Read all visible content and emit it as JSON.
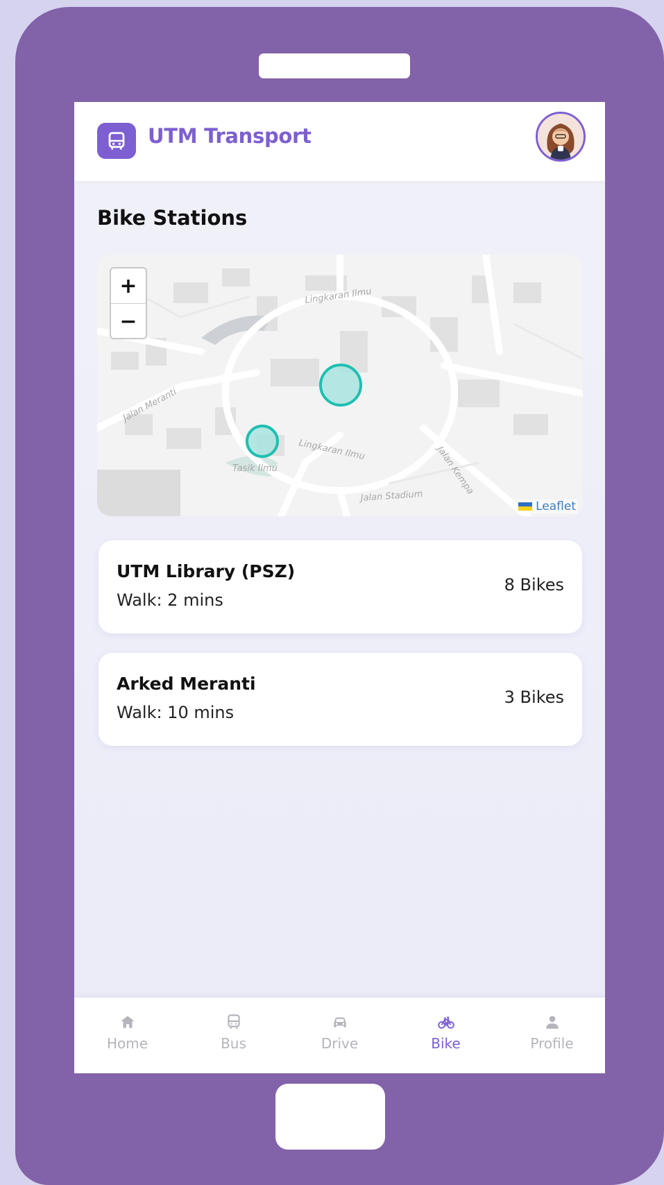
{
  "app": {
    "title": "UTM Transport",
    "logo_icon": "bus-icon",
    "accent_color": "#7d5fd2"
  },
  "page": {
    "title": "Bike Stations"
  },
  "map": {
    "labels": [
      "Lingkaran Ilmu",
      "Jalan Meranti",
      "Lingkaran Ilmu",
      "Tasik Ilmu",
      "Jalan Stadium",
      "Jalan Kempa"
    ],
    "zoom_in": "+",
    "zoom_out": "−",
    "attribution": "Leaflet",
    "marker_color": "#1fbfb2"
  },
  "stations": [
    {
      "name": "UTM Library (PSZ)",
      "walk": "Walk: 2 mins",
      "bikes": "8 Bikes"
    },
    {
      "name": "Arked Meranti",
      "walk": "Walk: 10 mins",
      "bikes": "3 Bikes"
    }
  ],
  "nav": {
    "items": [
      {
        "label": "Home",
        "icon": "home-icon"
      },
      {
        "label": "Bus",
        "icon": "bus-icon"
      },
      {
        "label": "Drive",
        "icon": "car-icon"
      },
      {
        "label": "Bike",
        "icon": "bike-icon",
        "active": true
      },
      {
        "label": "Profile",
        "icon": "person-icon"
      }
    ]
  }
}
